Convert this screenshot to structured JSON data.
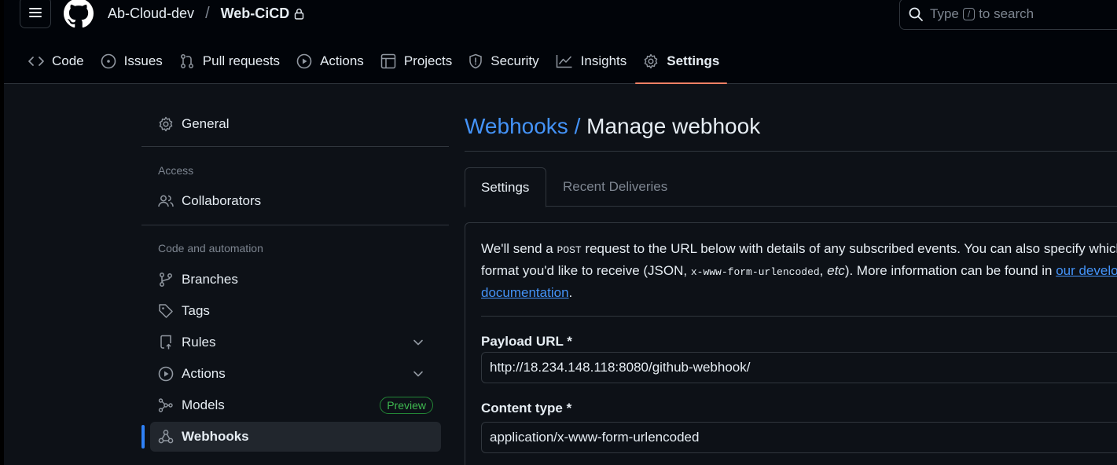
{
  "header": {
    "owner": "Ab-Cloud-dev",
    "separator": "/",
    "repo": "Web-CiCD",
    "search": {
      "prefix": "Type",
      "key": "/",
      "suffix": "to search"
    }
  },
  "nav": {
    "code": "Code",
    "issues": "Issues",
    "pull_requests": "Pull requests",
    "actions": "Actions",
    "projects": "Projects",
    "security": "Security",
    "insights": "Insights",
    "settings": "Settings"
  },
  "sidebar": {
    "general": "General",
    "access_heading": "Access",
    "collaborators": "Collaborators",
    "automation_heading": "Code and automation",
    "branches": "Branches",
    "tags": "Tags",
    "rules": "Rules",
    "actions": "Actions",
    "models": "Models",
    "models_badge": "Preview",
    "webhooks": "Webhooks"
  },
  "main": {
    "title_link": "Webhooks",
    "title_sep": "/",
    "title": "Manage webhook",
    "tabs": [
      "Settings",
      "Recent Deliveries"
    ],
    "desc": {
      "p1": "We'll send a ",
      "code1": "POST",
      "p2": " request to the URL below with details of any subscribed events. You can also specify which data",
      "p3": "format you'd like to receive (JSON, ",
      "code2": "x-www-form-urlencoded",
      "p4": ", ",
      "etc": "etc",
      "p5": "). More information can be found in ",
      "link1": "our developer",
      "link2": "documentation",
      "p6": "."
    },
    "payload_label": "Payload URL *",
    "payload_value": "http://18.234.148.118:8080/github-webhook/",
    "content_label": "Content type *",
    "content_value": "application/x-www-form-urlencoded"
  },
  "colors": {
    "background": "#0d1117",
    "link": "#4493f8",
    "active_tab_underline": "#f78166",
    "selected_indicator": "#2f81f7",
    "badge_green": "#3fb950"
  }
}
